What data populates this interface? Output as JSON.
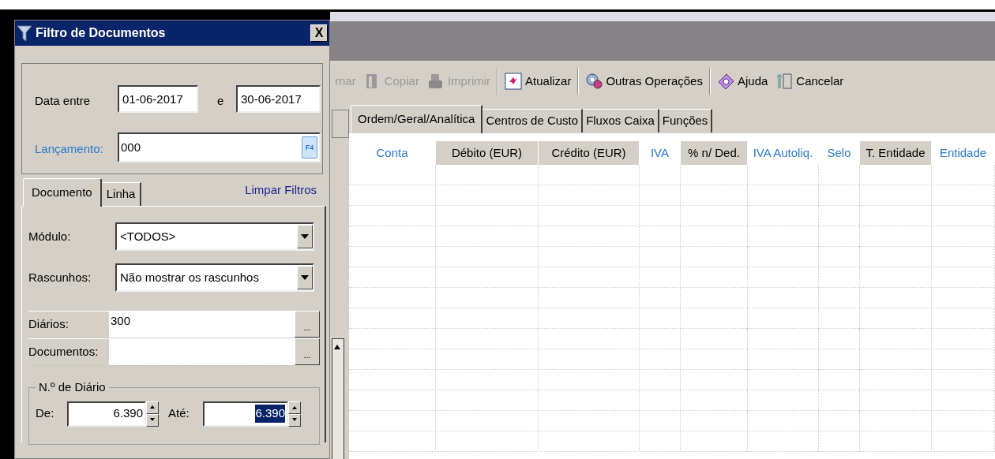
{
  "dialog": {
    "title": "Filtro de Documentos",
    "close": "X",
    "date_label": "Data entre",
    "date_from": "01-06-2017",
    "date_sep": "e",
    "date_to": "30-06-2017",
    "lancamento_label": "Lançamento:",
    "lancamento_value": "000",
    "lancamento_button": "F4",
    "tabs": [
      {
        "label": "Documento",
        "selected": true
      },
      {
        "label": "Linha",
        "selected": false
      }
    ],
    "clear_link": "Limpar Filtros",
    "dropdowns": [
      {
        "label": "Módulo:",
        "value": "<TODOS>"
      },
      {
        "label": "Rascunhos:",
        "value": "Não mostrar os rascunhos"
      }
    ],
    "pickers": [
      {
        "label": "Diários:",
        "value": "300",
        "button": "..."
      },
      {
        "label": "Documentos:",
        "button": "..."
      }
    ],
    "group": {
      "title": "N.º de Diário",
      "from_label": "De:",
      "from_value": "6.390",
      "to_label": "Até:",
      "to_value": "6.390"
    }
  },
  "toolbar": [
    {
      "label": "rnar",
      "disabled": true,
      "kind": "cut"
    },
    {
      "label": "Copiar",
      "disabled": true,
      "kind": "copy"
    },
    {
      "label": "Imprimir",
      "disabled": true,
      "kind": "print"
    },
    {
      "label": "Atualizar",
      "disabled": false,
      "kind": "refresh"
    },
    {
      "label": "Outras Operações",
      "disabled": false,
      "kind": "gears"
    },
    {
      "label": "Ajuda",
      "disabled": false,
      "kind": "help"
    },
    {
      "label": "Cancelar",
      "disabled": false,
      "kind": "cancel"
    }
  ],
  "tabs": [
    {
      "label": "Ordem/Geral/Analítica",
      "selected": true
    },
    {
      "label": "Centros de Custo",
      "selected": false
    },
    {
      "label": "Fluxos Caixa",
      "selected": false
    },
    {
      "label": "Funções",
      "selected": false
    }
  ],
  "table": {
    "columns": [
      {
        "label": "Conta",
        "kind": "link"
      },
      {
        "label": "Débito (EUR)",
        "kind": "plain"
      },
      {
        "label": "Crédito (EUR)",
        "kind": "plain"
      },
      {
        "label": "IVA",
        "kind": "link"
      },
      {
        "label": "% n/ Ded.",
        "kind": "plain"
      },
      {
        "label": "IVA Autoliq.",
        "kind": "link"
      },
      {
        "label": "Selo",
        "kind": "link"
      },
      {
        "label": "T. Entidade",
        "kind": "plain"
      },
      {
        "label": "Entidade",
        "kind": "link"
      }
    ]
  }
}
